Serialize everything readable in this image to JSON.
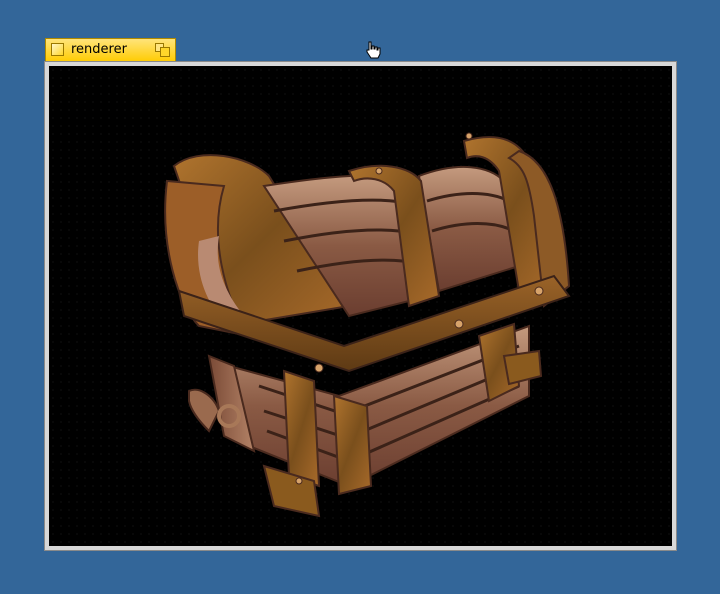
{
  "window": {
    "title": "renderer"
  },
  "icons": {
    "close": "close-box-icon",
    "zoom": "zoom-box-icon",
    "cursor": "hand-pointer-icon"
  },
  "colors": {
    "desktop": "#336699",
    "tab": "#ffcb00",
    "frame": "#d8d8d8",
    "viewport": "#000000",
    "wood": "#9b6a4c",
    "metal_band": "#8a5a1e"
  },
  "scene": {
    "object": "treasure-chest"
  }
}
